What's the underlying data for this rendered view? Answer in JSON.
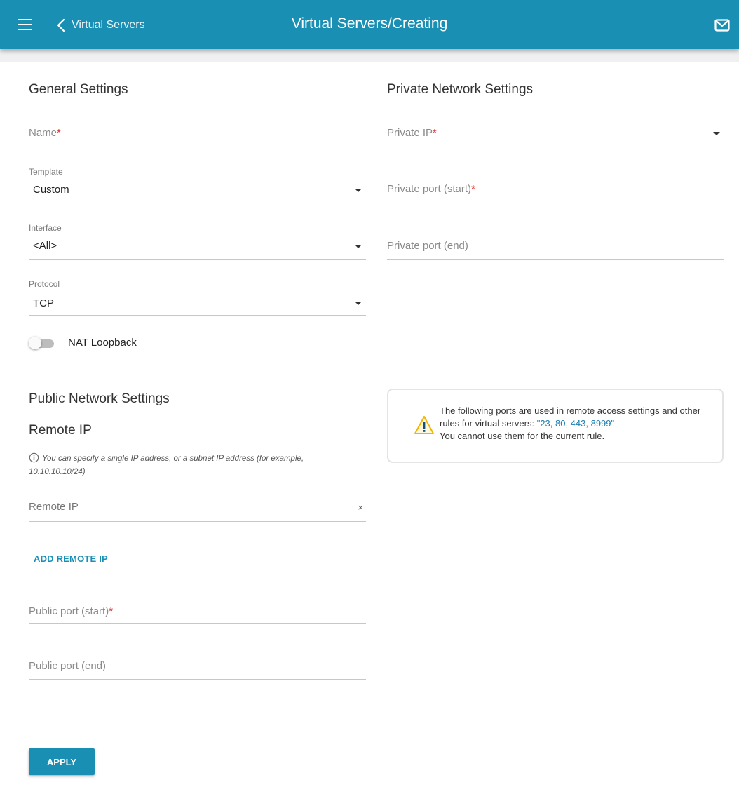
{
  "header": {
    "back_label": "Virtual Servers",
    "title": "Virtual Servers/Creating"
  },
  "general": {
    "title": "General Settings",
    "name_placeholder": "Name",
    "template_label": "Template",
    "template_value": "Custom",
    "interface_label": "Interface",
    "interface_value": "<All>",
    "protocol_label": "Protocol",
    "protocol_value": "TCP",
    "nat_loopback_label": "NAT Loopback",
    "nat_loopback_enabled": false
  },
  "public": {
    "title": "Public Network Settings",
    "remote_ip_title": "Remote IP",
    "hint": "You can specify a single IP address, or a subnet IP address (for example, 10.10.10.10/24)",
    "remote_ip_placeholder": "Remote IP",
    "clear_symbol": "×",
    "add_remote_ip_label": "ADD REMOTE IP",
    "public_port_start_placeholder": "Public port (start)",
    "public_port_end_placeholder": "Public port (end)"
  },
  "private": {
    "title": "Private Network Settings",
    "private_ip_placeholder": "Private IP",
    "private_port_start_placeholder": "Private port (start)",
    "private_port_end_placeholder": "Private port (end)"
  },
  "notice": {
    "text_before": "The following ports are used in remote access settings and other rules for virtual servers: ",
    "ports": "\"23, 80, 443, 8999\"",
    "text_after": "You cannot use them for the current rule."
  },
  "required_mark": "*",
  "apply_label": "APPLY",
  "colors": {
    "accent": "#1a8fb4",
    "required": "#e0322b",
    "warning": "#f4b400"
  },
  "icons": {
    "menu": "hamburger-icon",
    "back": "chevron-left-icon",
    "mail": "mail-icon",
    "info": "info-icon",
    "warning": "warning-icon"
  }
}
